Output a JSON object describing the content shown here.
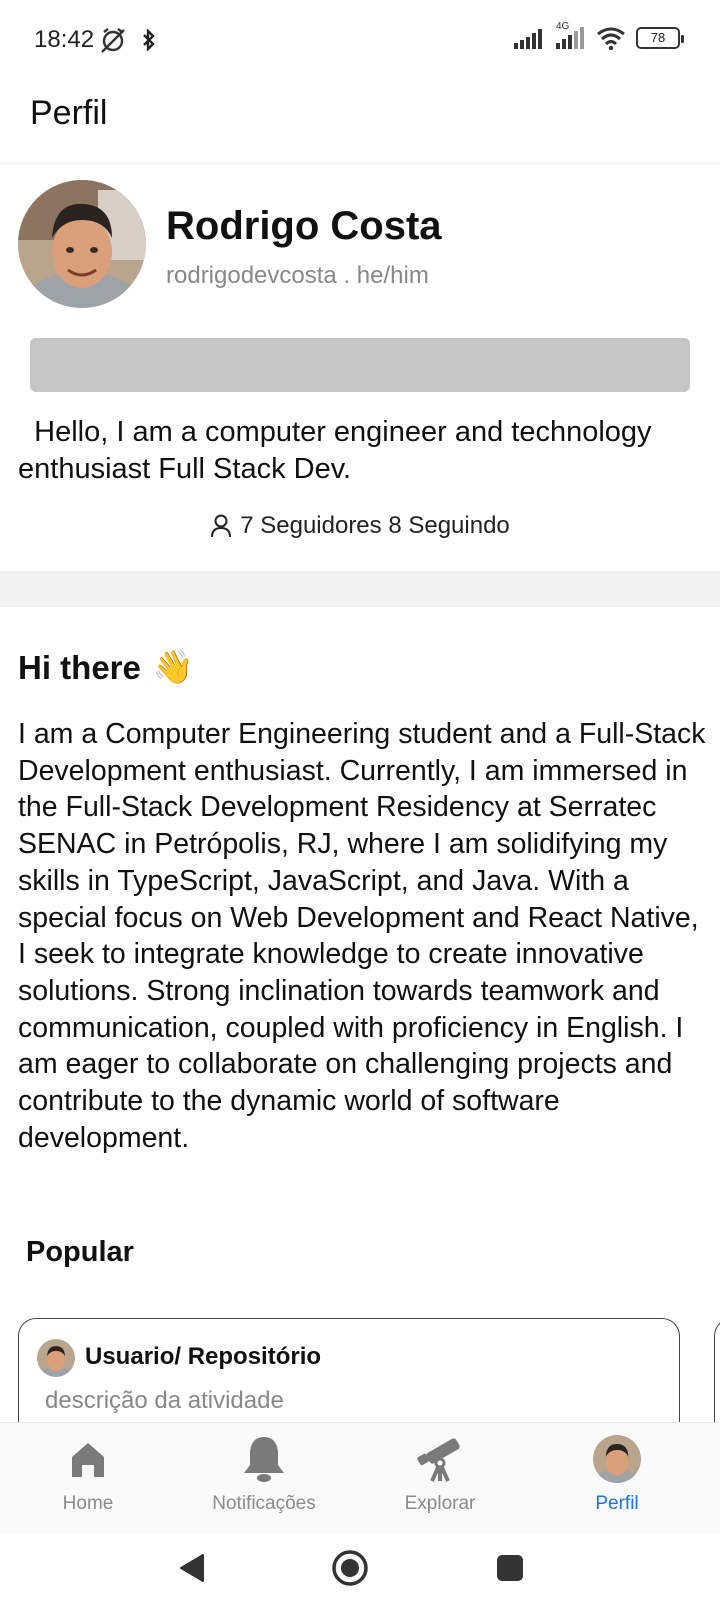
{
  "status_bar": {
    "time": "18:42",
    "network": "4G",
    "battery": "78"
  },
  "header": {
    "title": "Perfil"
  },
  "profile": {
    "name": "Rodrigo Costa",
    "handle": "rodrigodevcosta . he/him",
    "bio": "Hello, I am a computer engineer and technology enthusiast Full Stack Dev.",
    "followers": "7 Seguidores 8 Seguindo"
  },
  "readme": {
    "title": "Hi there",
    "emoji": "👋",
    "body": "I am a Computer Engineering student and a Full-Stack Development enthusiast. Currently, I am immersed in the Full-Stack Development Residency at Serratec SENAC in Petrópolis, RJ, where I am solidifying my skills in TypeScript, JavaScript, and Java. With a special focus on Web Development and React Native, I seek to integrate knowledge to create innovative solutions. Strong inclination towards teamwork and communication, coupled with proficiency in English. I am eager to collaborate on challenging projects and contribute to the dynamic world of software development."
  },
  "popular": {
    "title": "Popular",
    "cards": [
      {
        "name": "Usuario/ Repositório",
        "description": "descrição da atividade"
      }
    ]
  },
  "bottom_nav": {
    "items": [
      {
        "label": "Home",
        "icon": "home-icon",
        "active": false
      },
      {
        "label": "Notificações",
        "icon": "bell-icon",
        "active": false
      },
      {
        "label": "Explorar",
        "icon": "telescope-icon",
        "active": false
      },
      {
        "label": "Perfil",
        "icon": "avatar",
        "active": true
      }
    ]
  },
  "colors": {
    "accent": "#1a73e8",
    "inactive": "#8a8a8a",
    "placeholder_bar": "#c6c6c6"
  }
}
